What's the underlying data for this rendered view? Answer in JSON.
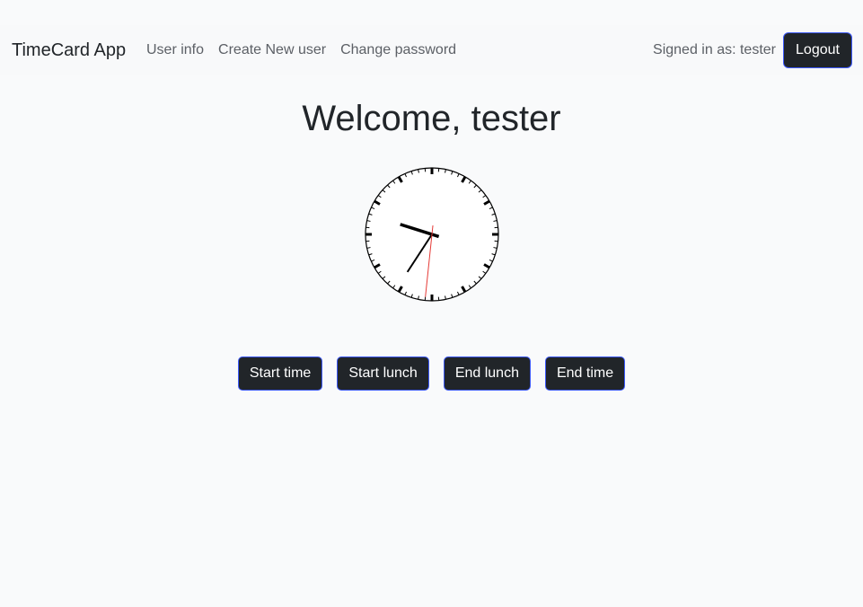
{
  "navbar": {
    "brand": "TimeCard App",
    "links": [
      {
        "label": "User info"
      },
      {
        "label": "Create New user"
      },
      {
        "label": "Change password"
      }
    ],
    "signed_in_text": "Signed in as: tester",
    "logout_label": "Logout"
  },
  "main": {
    "welcome_title": "Welcome, tester",
    "clock": {
      "hour": 9,
      "minute": 35,
      "second": 31,
      "second_hand_color": "#e53935"
    },
    "buttons": [
      {
        "label": "Start time"
      },
      {
        "label": "Start lunch"
      },
      {
        "label": "End lunch"
      },
      {
        "label": "End time"
      }
    ]
  },
  "colors": {
    "button_bg": "#212529",
    "button_border": "#3d5afe",
    "page_bg": "#f9fafb",
    "navbar_bg": "#f8f9fa"
  }
}
